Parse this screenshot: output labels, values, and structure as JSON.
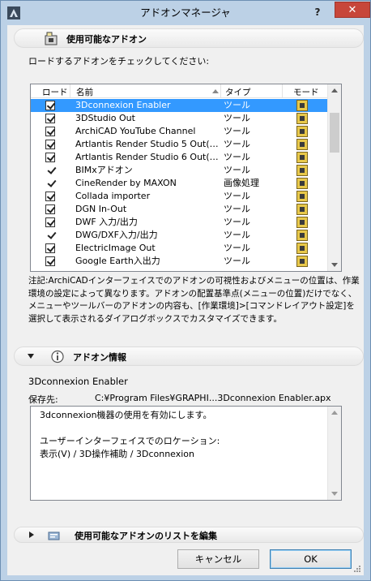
{
  "window": {
    "title": "アドオンマネージャ",
    "help_label": "?",
    "close_label": "✕"
  },
  "available_section": {
    "title": "使用可能なアドオン",
    "instruction": "ロードするアドオンをチェックしてください:"
  },
  "addon_list": {
    "columns": {
      "load": "ロード",
      "name": "名前",
      "type": "タイプ",
      "mode": "モード"
    },
    "rows": [
      {
        "name": "3Dconnexion Enabler",
        "type": "ツール",
        "check": "box",
        "selected": true
      },
      {
        "name": "3DStudio Out",
        "type": "ツール",
        "check": "box",
        "selected": false
      },
      {
        "name": "ArchiCAD YouTube Channel",
        "type": "ツール",
        "check": "box",
        "selected": false
      },
      {
        "name": "Artlantis Render Studio 5 Out(…",
        "type": "ツール",
        "check": "box",
        "selected": false
      },
      {
        "name": "Artlantis Render Studio 6 Out(…",
        "type": "ツール",
        "check": "box",
        "selected": false
      },
      {
        "name": "BIMxアドオン",
        "type": "ツール",
        "check": "tick",
        "selected": false
      },
      {
        "name": "CineRender by MAXON",
        "type": "画像処理",
        "check": "tick",
        "selected": false
      },
      {
        "name": "Collada importer",
        "type": "ツール",
        "check": "box",
        "selected": false
      },
      {
        "name": "DGN In-Out",
        "type": "ツール",
        "check": "box",
        "selected": false
      },
      {
        "name": "DWF 入力/出力",
        "type": "ツール",
        "check": "box",
        "selected": false
      },
      {
        "name": "DWG/DXF入力/出力",
        "type": "ツール",
        "check": "tick",
        "selected": false
      },
      {
        "name": "ElectricImage Out",
        "type": "ツール",
        "check": "box",
        "selected": false
      },
      {
        "name": "Google Earth入出力",
        "type": "ツール",
        "check": "box",
        "selected": false
      }
    ]
  },
  "note": "注記:ArchiCADインターフェイスでのアドオンの可視性およびメニューの位置は、作業環境の設定によって異なります。アドオンの配置基準点(メニューの位置)だけでなく、メニューやツールバーのアドオンの内容も、[作業環境]>[コマンドレイアウト設定]を選択して表示されるダイアログボックスでカスタマイズできます。",
  "info_section": {
    "title": "アドオン情報",
    "addon_name": "3Dconnexion Enabler",
    "path_label": "保存先:",
    "path_value": "C:¥Program Files¥GRAPHI...3Dconnexion Enabler.apx",
    "description": "3dconnexion機器の使用を有効にします。\n\nユーザーインターフェイスでのロケーション:\n表示(V) / 3D操作補助 / 3Dconnexion"
  },
  "edit_section": {
    "title": "使用可能なアドオンのリストを編集"
  },
  "buttons": {
    "cancel": "キャンセル",
    "ok": "OK"
  },
  "colors": {
    "selection": "#3399ff",
    "close_button": "#c7463a",
    "window_frame": "#bcd1e6"
  },
  "icons": [
    "app-icon",
    "help-icon",
    "close-icon",
    "addon-folder-icon",
    "info-icon",
    "edit-list-icon",
    "mode-icon",
    "checkbox-icon",
    "check-icon",
    "sort-arrow-icon",
    "scroll-up-icon",
    "scroll-down-icon",
    "disclosure-triangle-icon"
  ]
}
